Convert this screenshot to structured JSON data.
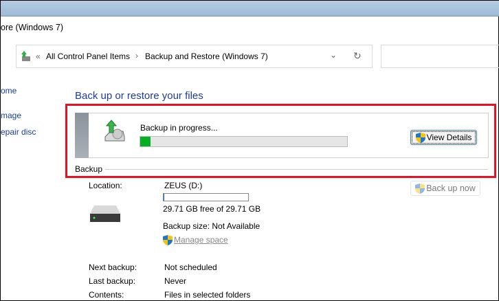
{
  "window": {
    "title": "ore (Windows 7)"
  },
  "address": {
    "sep": "«",
    "crumbs": [
      "All Control Panel Items",
      "Backup and Restore (Windows 7)"
    ]
  },
  "nav": [
    "ome",
    "mage",
    "epair disc"
  ],
  "heading": "Back up or restore your files",
  "progress": {
    "status": "Backup in progress...",
    "percent": 5,
    "button": "View Details"
  },
  "backup": {
    "section": "Backup",
    "location_label": "Location:",
    "location": "ZEUS (D:)",
    "disk_used_percent": 0,
    "free": "29.71 GB free of 29.71 GB",
    "size": "Backup size: Not Available",
    "manage": "Manage space",
    "back_up_now": "Back up now",
    "rows": [
      [
        "Next backup:",
        "Not scheduled"
      ],
      [
        "Last backup:",
        "Never"
      ],
      [
        "Contents:",
        "Files in selected folders"
      ]
    ]
  },
  "colors": {
    "accent": "#1e3b9a",
    "highlight": "#e81123",
    "progress": "#06b025"
  }
}
